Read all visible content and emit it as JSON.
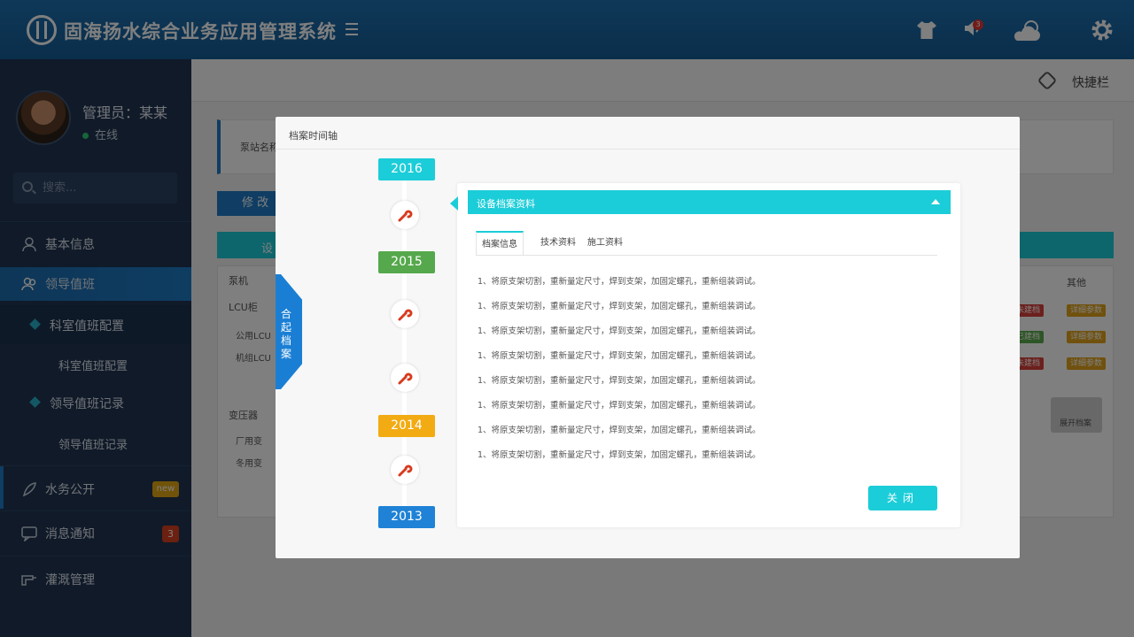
{
  "app": {
    "title": "固海扬水综合业务应用管理系统"
  },
  "header": {
    "notification_count": "3",
    "icons": [
      "shirt-icon",
      "speaker-icon",
      "weather-icon",
      "gear-icon"
    ]
  },
  "user": {
    "name": "管理员：某某",
    "status": "在线"
  },
  "search": {
    "placeholder": "搜索..."
  },
  "sidebar": {
    "items": [
      {
        "label": "基本信息",
        "icon": "user-icon"
      },
      {
        "label": "领导值班",
        "icon": "users-icon"
      },
      {
        "label": "水务公开",
        "icon": "feather-icon",
        "badge": "new"
      },
      {
        "label": "消息通知",
        "icon": "chat-icon",
        "badge": "3"
      },
      {
        "label": "灌溉管理",
        "icon": "pipe-icon"
      }
    ],
    "sub": [
      {
        "label": "科室值班配置",
        "child": "科室值班配置"
      },
      {
        "label": "领导值班记录",
        "child": "领导值班记录"
      }
    ]
  },
  "quickbar": {
    "label": "快捷栏"
  },
  "background": {
    "station_label": "泵站名称",
    "edit_btn": "修 改",
    "tab_label": "设",
    "pump": "泵机",
    "lcu": "LCU柜",
    "lcu_items": [
      "公用LCU",
      "机组LCU"
    ],
    "transformer": "变压器",
    "transformer_items": [
      "厂用变",
      "冬用变"
    ],
    "other": "其他",
    "tags": [
      {
        "label": "未建档",
        "color": "#d9413a"
      },
      {
        "label": "详细参数",
        "color": "#e0a21a"
      },
      {
        "label": "已建档",
        "color": "#5aaa4a"
      },
      {
        "label": "详细参数",
        "color": "#e0a21a"
      },
      {
        "label": "未建档",
        "color": "#d9413a"
      },
      {
        "label": "详细参数",
        "color": "#e0a21a"
      }
    ],
    "expand_archive": "展开档案"
  },
  "modal": {
    "title": "档案时间轴",
    "side_tab": "合起档案",
    "years": [
      {
        "label": "2016",
        "color": "#1bcdd8"
      },
      {
        "label": "2015",
        "color": "#55a84b"
      },
      {
        "label": "2014",
        "color": "#f2ab12"
      },
      {
        "label": "2013",
        "color": "#1f82d6"
      }
    ],
    "panel_title": "设备档案资料",
    "tabs": [
      "档案信息",
      "技术资料",
      "施工资料"
    ],
    "lines": [
      "1、将原支架切割，重新量定尺寸，焊到支架，加固定螺孔，重新组装调试。",
      "1、将原支架切割，重新量定尺寸，焊到支架，加固定螺孔，重新组装调试。",
      "1、将原支架切割，重新量定尺寸，焊到支架，加固定螺孔，重新组装调试。",
      "1、将原支架切割，重新量定尺寸，焊到支架，加固定螺孔，重新组装调试。",
      "1、将原支架切割，重新量定尺寸，焊到支架，加固定螺孔，重新组装调试。",
      "1、将原支架切割，重新量定尺寸，焊到支架，加固定螺孔，重新组装调试。",
      "1、将原支架切割，重新量定尺寸，焊到支架，加固定螺孔，重新组装调试。",
      "1、将原支架切割，重新量定尺寸，焊到支架，加固定螺孔，重新组装调试。"
    ],
    "close_btn": "关闭"
  }
}
